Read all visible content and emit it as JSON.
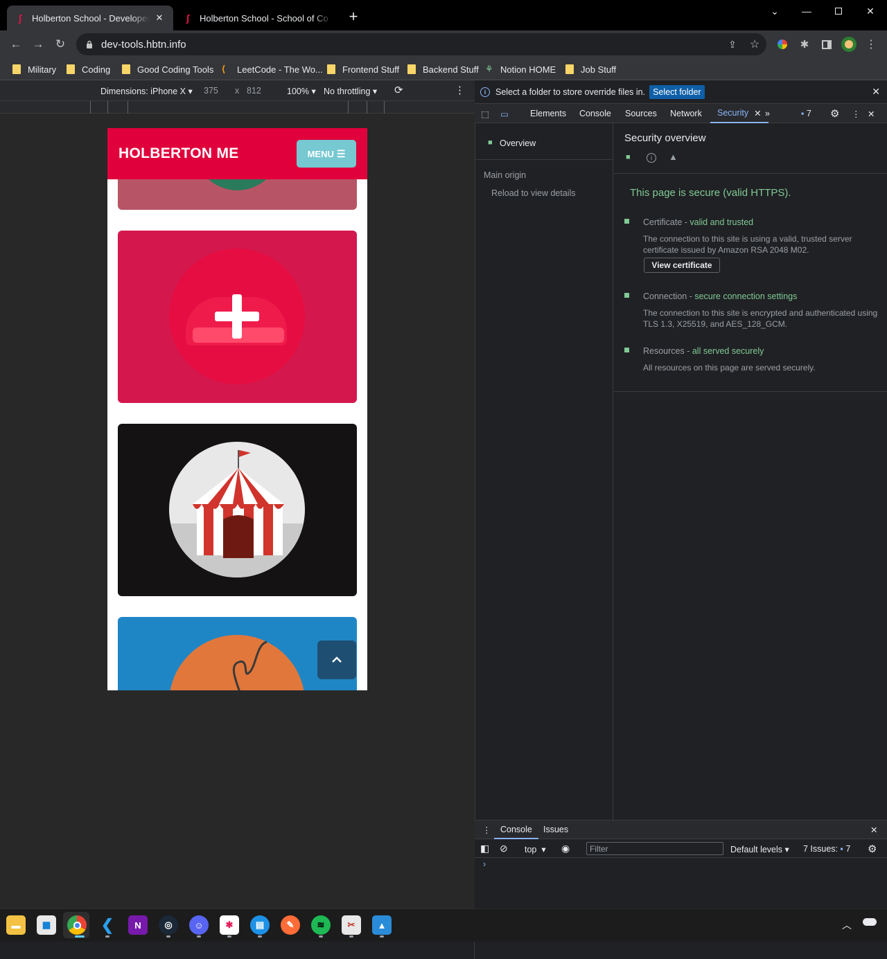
{
  "browser": {
    "tabs": [
      {
        "title": "Holberton School - Developer to",
        "active": true
      },
      {
        "title": "Holberton School - School of Co",
        "active": false
      }
    ],
    "new_tab": "+",
    "url": "dev-tools.hbtn.info",
    "window_controls": [
      "minimize",
      "maximize",
      "close"
    ]
  },
  "bookmarks": [
    {
      "label": "Military",
      "icon": "folder-icon"
    },
    {
      "label": "Coding",
      "icon": "folder-icon"
    },
    {
      "label": "Good Coding Tools",
      "icon": "folder-icon"
    },
    {
      "label": "LeetCode - The Wo...",
      "icon": "leetcode-icon"
    },
    {
      "label": "Frontend Stuff",
      "icon": "folder-icon"
    },
    {
      "label": "Backend Stuff",
      "icon": "folder-icon"
    },
    {
      "label": "Notion HOME",
      "icon": "notion-icon"
    },
    {
      "label": "Job Stuff",
      "icon": "folder-icon"
    }
  ],
  "device_toolbar": {
    "dimensions": "Dimensions: iPhone X",
    "width": "375",
    "times": "x",
    "height": "812",
    "zoom": "100%",
    "throttling": "No throttling"
  },
  "site": {
    "logo": "HOLBERTON ME",
    "menu": "MENU"
  },
  "devtools": {
    "infobar": {
      "message": "Select a folder to store override files in.",
      "button": "Select folder"
    },
    "tabs": [
      "Elements",
      "Console",
      "Sources",
      "Network",
      "Security"
    ],
    "active_tab": "Security",
    "issues_count": "7",
    "security": {
      "sidebar_overview": "Overview",
      "main_origin": "Main origin",
      "reload": "Reload to view details",
      "title": "Security overview",
      "secure_msg": "This page is secure (valid HTTPS).",
      "certificate": {
        "label": "Certificate - ",
        "status": "valid and trusted",
        "desc1": "The connection to this site is using a valid, trusted server",
        "desc2": "certificate issued by Amazon RSA 2048 M02.",
        "button": "View certificate"
      },
      "connection": {
        "label": "Connection - ",
        "status": "secure connection settings",
        "desc1": "The connection to this site is encrypted and authenticated using",
        "desc2": "TLS 1.3, X25519, and AES_128_GCM."
      },
      "resources": {
        "label": "Resources - ",
        "status": "all served securely",
        "desc1": "All resources on this page are served securely."
      }
    },
    "drawer": {
      "tabs": [
        "Console",
        "Issues"
      ],
      "context": "top",
      "filter_placeholder": "Filter",
      "levels": "Default levels",
      "issues_label": "7 Issues:",
      "issues_count": "7",
      "prompt": "›"
    }
  },
  "colors": {
    "accent": "#8ab4f8",
    "secure_green": "#81c995",
    "holberton_red": "#e0003c",
    "menu_teal": "#76c8d1"
  },
  "taskbar": [
    "file-explorer-icon",
    "microsoft-store-icon",
    "chrome-icon",
    "vscode-icon",
    "onenote-icon",
    "steam-icon",
    "discord-icon",
    "slack-icon",
    "docker-icon",
    "postman-icon",
    "spotify-icon",
    "snipping-tool-icon",
    "photos-icon"
  ]
}
